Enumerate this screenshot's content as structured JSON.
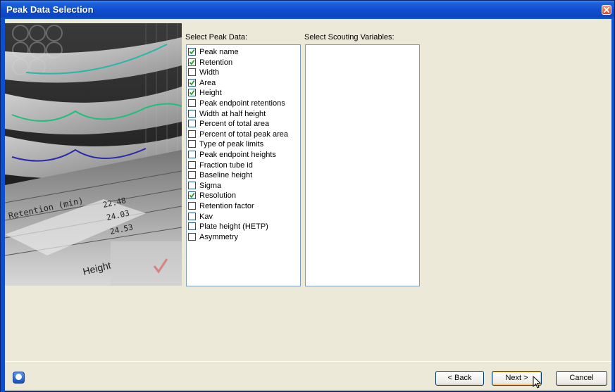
{
  "window": {
    "title": "Peak Data Selection"
  },
  "peak_data": {
    "label": "Select Peak Data:",
    "items": [
      {
        "label": "Peak name",
        "checked": true
      },
      {
        "label": "Retention",
        "checked": true
      },
      {
        "label": "Width",
        "checked": false
      },
      {
        "label": "Area",
        "checked": true
      },
      {
        "label": "Height",
        "checked": true
      },
      {
        "label": "Peak endpoint retentions",
        "checked": false
      },
      {
        "label": "Width at half height",
        "checked": false
      },
      {
        "label": "Percent of total area",
        "checked": false
      },
      {
        "label": "Percent of total peak area",
        "checked": false
      },
      {
        "label": "Type of peak limits",
        "checked": false
      },
      {
        "label": "Peak endpoint heights",
        "checked": false
      },
      {
        "label": "Fraction tube id",
        "checked": false
      },
      {
        "label": "Baseline height",
        "checked": false
      },
      {
        "label": "Sigma",
        "checked": false
      },
      {
        "label": "Resolution",
        "checked": true
      },
      {
        "label": "Retention factor",
        "checked": false
      },
      {
        "label": "Kav",
        "checked": false
      },
      {
        "label": "Plate height (HETP)",
        "checked": false
      },
      {
        "label": "Asymmetry",
        "checked": false
      }
    ]
  },
  "scouting": {
    "label": "Select Scouting Variables:",
    "items": []
  },
  "buttons": {
    "back": "< Back",
    "next": "Next >",
    "cancel": "Cancel"
  },
  "art_text": {
    "retention": "Retention (min)",
    "height": "Height",
    "values": [
      "22.48",
      "24.03",
      "24.53"
    ]
  }
}
